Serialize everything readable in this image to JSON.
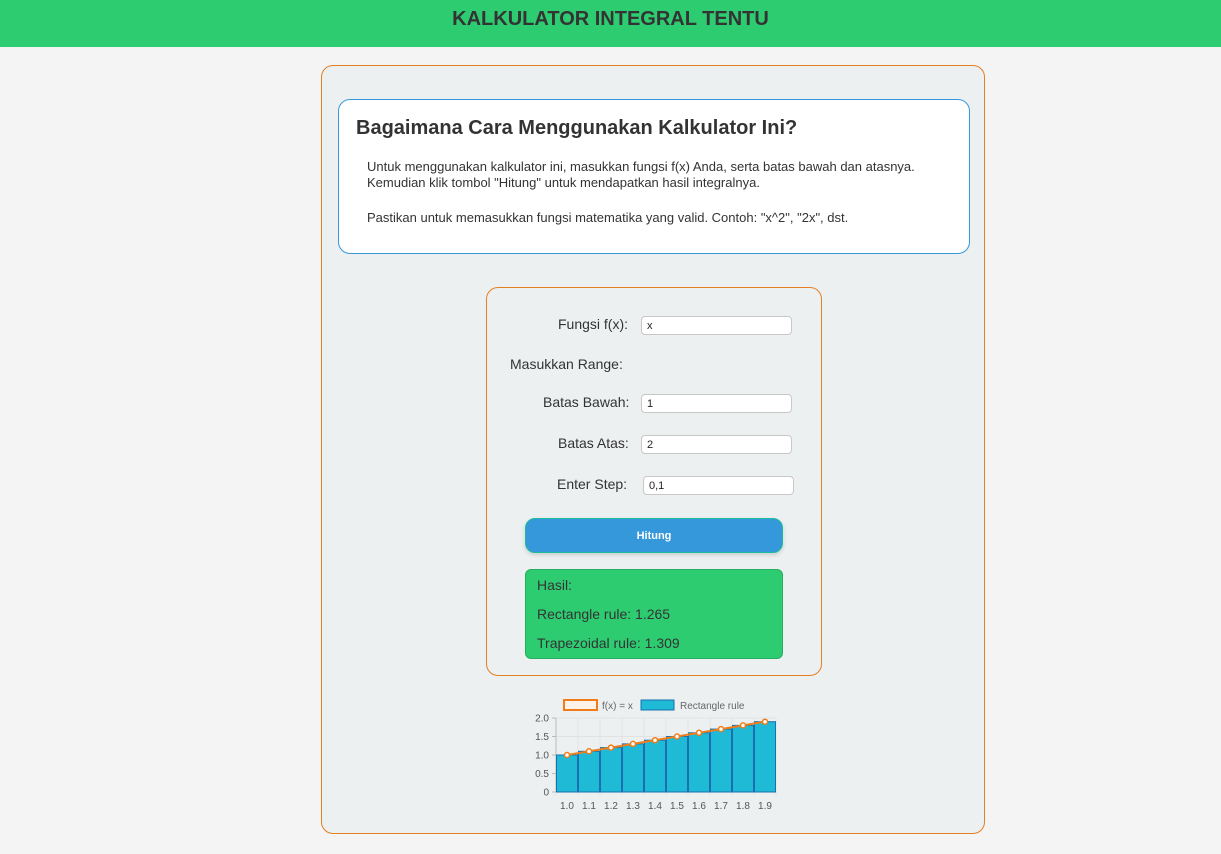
{
  "header": {
    "title": "KALKULATOR INTEGRAL TENTU"
  },
  "howto": {
    "title": "Bagaimana Cara Menggunakan Kalkulator Ini?",
    "line1": "Untuk menggunakan kalkulator ini, masukkan fungsi f(x) Anda, serta batas bawah dan atasnya.",
    "line2": "Kemudian klik tombol \"Hitung\" untuk mendapatkan hasil integralnya.",
    "line3": "Pastikan untuk memasukkan fungsi matematika yang valid. Contoh: \"x^2\", \"2x\", dst."
  },
  "form": {
    "function_label": "Fungsi f(x):",
    "function_value": "x",
    "range_label": "Masukkan Range:",
    "lower_label": "Batas Bawah:",
    "lower_value": "1",
    "upper_label": "Batas Atas:",
    "upper_value": "2",
    "step_label": "Enter Step:",
    "step_value": "0,1",
    "submit_label": "Hitung"
  },
  "result": {
    "heading": "Hasil:",
    "rectangle": "Rectangle rule: 1.265",
    "trapezoidal": "Trapezoidal rule: 1.309"
  },
  "colors": {
    "header_bg": "#2ecc71",
    "accent_orange": "#e67e22",
    "accent_blue": "#3498db",
    "bar_fill": "#1fbad6",
    "line": "#f07d1a"
  },
  "chart_data": {
    "type": "bar",
    "categories": [
      "1.0",
      "1.1",
      "1.2",
      "1.3",
      "1.4",
      "1.5",
      "1.6",
      "1.7",
      "1.8",
      "1.9"
    ],
    "series": [
      {
        "name": "f(x) = x",
        "type": "line",
        "values": [
          1.0,
          1.1,
          1.2,
          1.3,
          1.4,
          1.5,
          1.6,
          1.7,
          1.8,
          1.9
        ]
      },
      {
        "name": "Rectangle rule",
        "type": "bar",
        "values": [
          1.0,
          1.1,
          1.2,
          1.3,
          1.4,
          1.5,
          1.6,
          1.7,
          1.8,
          1.9
        ]
      }
    ],
    "yticks": [
      "0",
      "0.5",
      "1.0",
      "1.5",
      "2.0"
    ],
    "ylim": [
      0,
      2.0
    ],
    "grid": true,
    "legend": "top"
  }
}
